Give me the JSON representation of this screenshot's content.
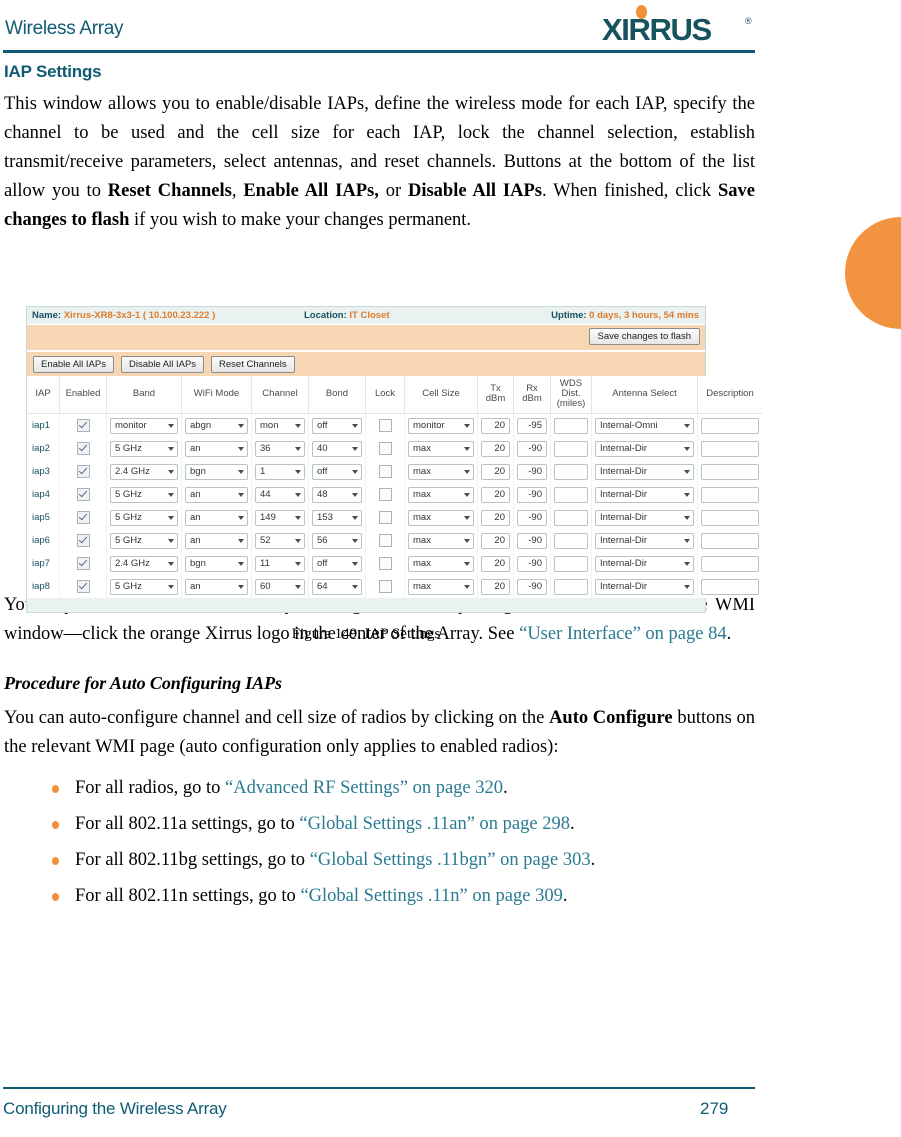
{
  "header": {
    "title": "Wireless Array",
    "logo_text": "XIRRUS",
    "logo_reg": "®"
  },
  "section": {
    "title": "IAP Settings",
    "intro_p1": "This window allows you to enable/disable IAPs, define the wireless mode for each IAP, specify the channel to be used and the cell size for each IAP, lock the channel selection, establish transmit/receive parameters, select antennas, and reset channels. Buttons at the bottom of the list allow you to ",
    "intro_b1": "Reset Channels",
    "intro_p2": ", ",
    "intro_b2": "Enable All IAPs,",
    "intro_p3": " or ",
    "intro_b3": "Disable All IAPs",
    "intro_p4": ". When finished, click ",
    "intro_b4": "Save changes to flash",
    "intro_p5": " if you wish to make your changes permanent."
  },
  "figure": {
    "caption": "Figure 149. IAP Settings",
    "status": {
      "name_label": "Name:",
      "name_value": "Xirrus-XR8-3x3-1   ( 10.100.23.222 )",
      "location_label": "Location:",
      "location_value": "IT Closet",
      "uptime_label": "Uptime:",
      "uptime_value": "0 days, 3 hours, 54 mins"
    },
    "buttons": {
      "save": "Save changes to flash",
      "enable_all": "Enable All IAPs",
      "disable_all": "Disable All IAPs",
      "reset_channels": "Reset Channels"
    },
    "columns": [
      "IAP",
      "Enabled",
      "Band",
      "WiFi Mode",
      "Channel",
      "Bond",
      "Lock",
      "Cell Size",
      "Tx dBm",
      "Rx dBm",
      "WDS Dist. (miles)",
      "Antenna Select",
      "Description"
    ],
    "column_headers": {
      "iap": "IAP",
      "enabled": "Enabled",
      "band": "Band",
      "wifi_mode": "WiFi Mode",
      "channel": "Channel",
      "bond": "Bond",
      "lock": "Lock",
      "cell_size": "Cell Size",
      "tx_line1": "Tx",
      "tx_line2": "dBm",
      "rx_line1": "Rx",
      "rx_line2": "dBm",
      "wds_line1": "WDS",
      "wds_line2": "Dist.",
      "wds_line3": "(miles)",
      "antenna": "Antenna Select",
      "description": "Description"
    },
    "rows": [
      {
        "iap": "iap1",
        "enabled": true,
        "band": "monitor",
        "wifi_mode": "abgn",
        "channel": "mon",
        "bond": "off",
        "lock": false,
        "cell_size": "monitor",
        "tx": "20",
        "rx": "-95",
        "wds": "",
        "antenna": "Internal-Omni",
        "description": ""
      },
      {
        "iap": "iap2",
        "enabled": true,
        "band": "5 GHz",
        "wifi_mode": "an",
        "channel": "36",
        "bond": "40",
        "lock": false,
        "cell_size": "max",
        "tx": "20",
        "rx": "-90",
        "wds": "",
        "antenna": "Internal-Dir",
        "description": ""
      },
      {
        "iap": "iap3",
        "enabled": true,
        "band": "2.4 GHz",
        "wifi_mode": "bgn",
        "channel": "1",
        "bond": "off",
        "lock": false,
        "cell_size": "max",
        "tx": "20",
        "rx": "-90",
        "wds": "",
        "antenna": "Internal-Dir",
        "description": ""
      },
      {
        "iap": "iap4",
        "enabled": true,
        "band": "5 GHz",
        "wifi_mode": "an",
        "channel": "44",
        "bond": "48",
        "lock": false,
        "cell_size": "max",
        "tx": "20",
        "rx": "-90",
        "wds": "",
        "antenna": "Internal-Dir",
        "description": ""
      },
      {
        "iap": "iap5",
        "enabled": true,
        "band": "5 GHz",
        "wifi_mode": "an",
        "channel": "149",
        "bond": "153",
        "lock": false,
        "cell_size": "max",
        "tx": "20",
        "rx": "-90",
        "wds": "",
        "antenna": "Internal-Dir",
        "description": ""
      },
      {
        "iap": "iap6",
        "enabled": true,
        "band": "5 GHz",
        "wifi_mode": "an",
        "channel": "52",
        "bond": "56",
        "lock": false,
        "cell_size": "max",
        "tx": "20",
        "rx": "-90",
        "wds": "",
        "antenna": "Internal-Dir",
        "description": ""
      },
      {
        "iap": "iap7",
        "enabled": true,
        "band": "2.4 GHz",
        "wifi_mode": "bgn",
        "channel": "11",
        "bond": "off",
        "lock": false,
        "cell_size": "max",
        "tx": "20",
        "rx": "-90",
        "wds": "",
        "antenna": "Internal-Dir",
        "description": ""
      },
      {
        "iap": "iap8",
        "enabled": true,
        "band": "5 GHz",
        "wifi_mode": "an",
        "channel": "60",
        "bond": "64",
        "lock": false,
        "cell_size": "max",
        "tx": "20",
        "rx": "-90",
        "wds": "",
        "antenna": "Internal-Dir",
        "description": ""
      }
    ]
  },
  "after_figure": {
    "para_1a": "You may also access this window by clicking on the Array image at the lower left of the WMI window—click the orange Xirrus logo in the center of the Array. See ",
    "para_1_link": "“User Interface” on page 84",
    "para_1b": "."
  },
  "procedure": {
    "heading": "Procedure for Auto Configuring IAPs",
    "intro_a": "You can auto-configure channel and cell size of radios by clicking on the ",
    "intro_b": "Auto Configure",
    "intro_c": " buttons on the relevant WMI page (auto configuration only applies to enabled radios):",
    "bullets": [
      {
        "text_a": "For all radios, go to ",
        "link": "“Advanced RF Settings” on page 320",
        "text_b": "."
      },
      {
        "text_a": "For all 802.11a settings, go to ",
        "link": "“Global Settings .11an” on page 298",
        "text_b": "."
      },
      {
        "text_a": "For all 802.11bg settings, go to ",
        "link": "“Global Settings .11bgn” on page 303",
        "text_b": "."
      },
      {
        "text_a": "For all 802.11n settings, go to ",
        "link": "“Global Settings .11n” on page 309",
        "text_b": "."
      }
    ]
  },
  "footer": {
    "left": "Configuring the Wireless Array",
    "page": "279"
  },
  "colors": {
    "brand_teal": "#0f5b73",
    "brand_orange": "#f2903b",
    "link": "#2a7b92",
    "wmi_status_bg": "#e9f2f1",
    "wmi_bar_bg": "#f7d6b4",
    "wmi_value_orange": "#e07b2a"
  }
}
